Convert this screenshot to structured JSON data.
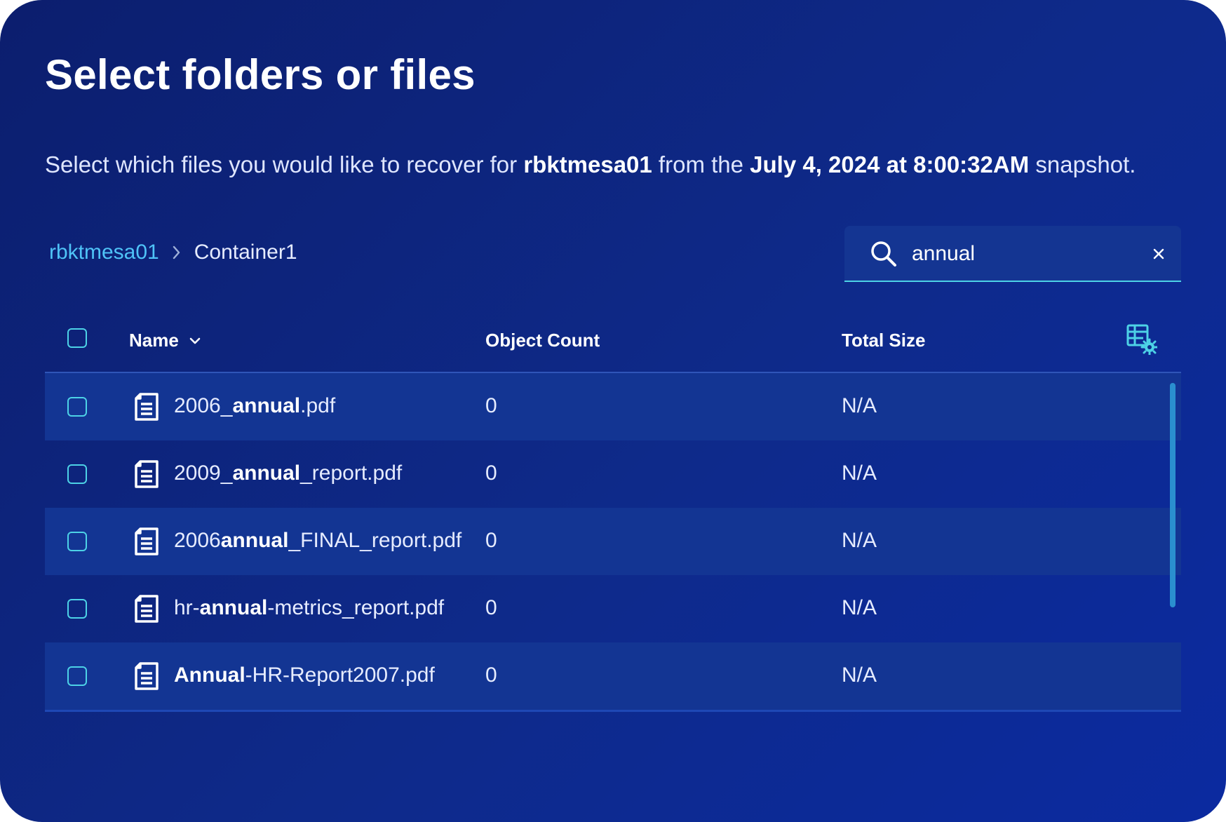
{
  "title": "Select folders or files",
  "subtitle": {
    "prefix": "Select which files you would like to recover for ",
    "target": "rbktmesa01",
    "middle": " from the ",
    "snapshot": "July 4, 2024 at 8:00:32AM",
    "suffix": " snapshot."
  },
  "breadcrumb": {
    "root": "rbktmesa01",
    "current": "Container1"
  },
  "search": {
    "value": "annual",
    "placeholder": ""
  },
  "table": {
    "columns": {
      "name": "Name",
      "object_count": "Object Count",
      "total_size": "Total Size"
    },
    "rows": [
      {
        "name_pre": "2006_",
        "name_match": "annual",
        "name_post": ".pdf",
        "object_count": "0",
        "total_size": "N/A"
      },
      {
        "name_pre": "2009_",
        "name_match": "annual",
        "name_post": "_report.pdf",
        "object_count": "0",
        "total_size": "N/A"
      },
      {
        "name_pre": "2006",
        "name_match": "annual",
        "name_post": "_FINAL_report.pdf",
        "object_count": "0",
        "total_size": "N/A"
      },
      {
        "name_pre": "hr-",
        "name_match": "annual",
        "name_post": "-metrics_report.pdf",
        "object_count": "0",
        "total_size": "N/A"
      },
      {
        "name_pre": "",
        "name_match": "Annual",
        "name_post": "-HR-Report2007.pdf",
        "object_count": "0",
        "total_size": "N/A"
      }
    ]
  },
  "colors": {
    "accent": "#4dd2e6",
    "link": "#4fc3f7",
    "panel_bg": "#0e2a8a"
  },
  "icons": {
    "search": "search-icon",
    "clear": "close-icon",
    "sort": "chevron-down-icon",
    "file": "document-icon",
    "column_settings": "table-settings-icon",
    "breadcrumb_separator": "chevron-right-icon"
  }
}
